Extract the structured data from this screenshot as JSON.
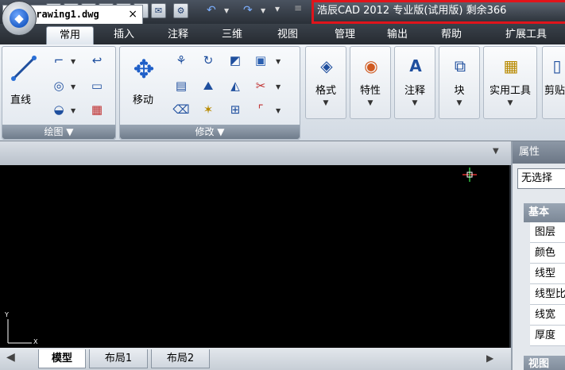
{
  "title": "浩辰CAD 2012 专业版(试用版) 剩余366",
  "tabs": [
    "常用",
    "插入",
    "注释",
    "三维",
    "视图",
    "管理",
    "输出",
    "帮助",
    "扩展工具"
  ],
  "panels": {
    "draw": {
      "label": "绘图",
      "tool": "直线"
    },
    "modify": {
      "label": "修改",
      "tool": "移动"
    }
  },
  "tools": [
    "格式",
    "特性",
    "注释",
    "块",
    "实用工具",
    "剪贴"
  ],
  "document": {
    "tab": "Drawing1.dwg",
    "close": "×"
  },
  "layout_tabs": [
    "模型",
    "布局1",
    "布局2"
  ],
  "properties": {
    "header": "属性",
    "selection": "无选择",
    "basic": "基本",
    "rows": [
      "图层",
      "颜色",
      "线型",
      "线型比",
      "线宽",
      "厚度"
    ],
    "view": "视图"
  },
  "axes": {
    "y": "Y",
    "x": "X"
  },
  "colors": {
    "highlight": "#e0141b",
    "canvas": "#000000"
  }
}
